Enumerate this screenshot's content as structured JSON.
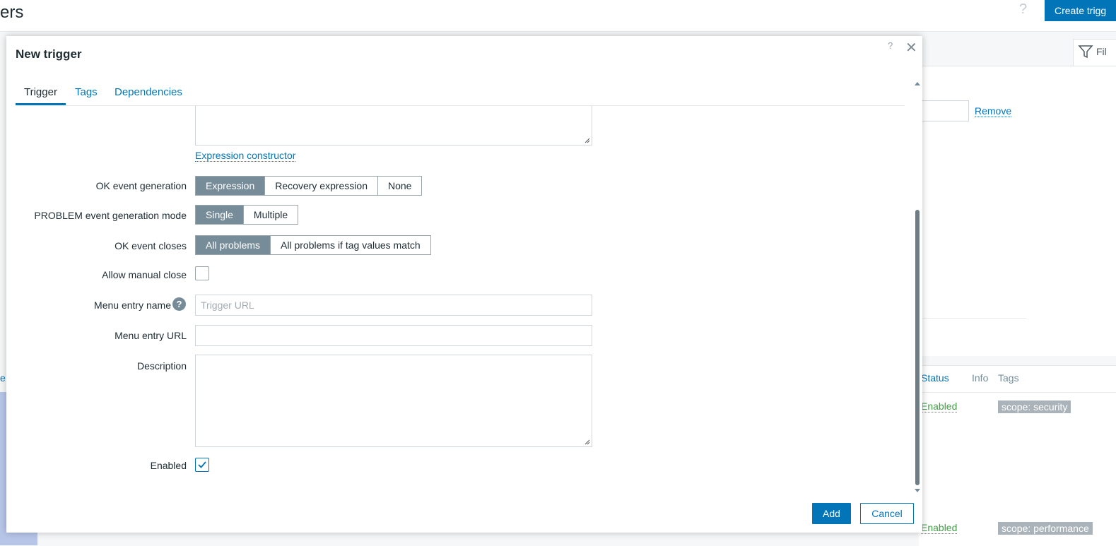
{
  "background": {
    "page_title": "ers",
    "help_icon": "?",
    "create_button": "Create trigg",
    "filter_tab": "Fil",
    "filter_remove": "Remove",
    "table_headers": {
      "status": "Status",
      "info": "Info",
      "tags": "Tags"
    },
    "left_header_fragment": "e",
    "rows": [
      {
        "status": "Enabled",
        "tag": "scope: security"
      },
      {
        "status": "Enabled",
        "tag": "scope: performance"
      }
    ]
  },
  "modal": {
    "title": "New trigger",
    "help": "?",
    "close": "✕",
    "tabs": [
      "Trigger",
      "Tags",
      "Dependencies"
    ],
    "expression_constructor": "Expression constructor",
    "ok_event_generation": {
      "label": "OK event generation",
      "options": [
        "Expression",
        "Recovery expression",
        "None"
      ],
      "selected": "Expression"
    },
    "problem_mode": {
      "label": "PROBLEM event generation mode",
      "options": [
        "Single",
        "Multiple"
      ],
      "selected": "Single"
    },
    "ok_event_closes": {
      "label": "OK event closes",
      "options": [
        "All problems",
        "All problems if tag values match"
      ],
      "selected": "All problems"
    },
    "allow_manual_close": {
      "label": "Allow manual close",
      "checked": false
    },
    "menu_entry_name": {
      "label": "Menu entry name",
      "placeholder": "Trigger URL",
      "value": ""
    },
    "menu_entry_url": {
      "label": "Menu entry URL",
      "value": ""
    },
    "description": {
      "label": "Description",
      "value": ""
    },
    "enabled": {
      "label": "Enabled",
      "checked": true
    },
    "buttons": {
      "add": "Add",
      "cancel": "Cancel"
    }
  },
  "colors": {
    "accent": "#0275b8",
    "segment_selected": "#768d99",
    "status_enabled": "#429e47",
    "tag_background": "#aab3b9"
  },
  "icons": [
    "help-icon",
    "close-icon",
    "filter-icon",
    "checkmark-icon",
    "scroll-up-icon",
    "scroll-down-icon"
  ]
}
